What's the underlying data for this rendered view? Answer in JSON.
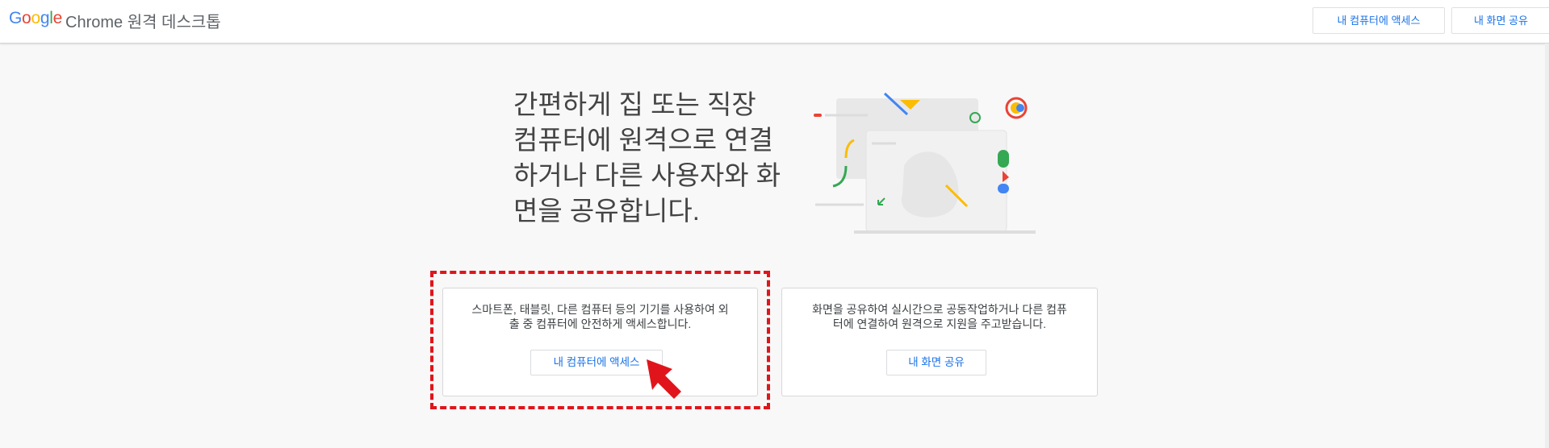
{
  "header": {
    "logo_letters": [
      "G",
      "o",
      "o",
      "g",
      "l",
      "e"
    ],
    "logo_colors": [
      "#4285f4",
      "#ea4335",
      "#fbbc05",
      "#4285f4",
      "#34a853",
      "#ea4335"
    ],
    "title": "Chrome 원격 데스크톱",
    "access_button": "내 컴퓨터에 액세스",
    "share_button": "내 화면 공유"
  },
  "hero": {
    "lines": [
      "간편하게 집 또는 직장",
      "컴퓨터에 원격으로 연결",
      "하거나 다른 사용자와 화",
      "면을 공유합니다."
    ]
  },
  "cards": {
    "access": {
      "desc_line1": "스마트폰, 태블릿, 다른 컴퓨터 등의 기기를 사용하여 외",
      "desc_line2": "출 중 컴퓨터에 안전하게 액세스합니다.",
      "button": "내 컴퓨터에 액세스"
    },
    "share": {
      "desc_line1": "화면을 공유하여 실시간으로 공동작업하거나 다른 컴퓨",
      "desc_line2": "터에 연결하여 원격으로 지원을 주고받습니다.",
      "button": "내 화면 공유"
    }
  },
  "colors": {
    "accent": "#1a73e8",
    "highlight": "#e0151b",
    "pointer": "#e0151b"
  },
  "icons": [
    "illustration-computers",
    "pointer-arrow-icon"
  ]
}
